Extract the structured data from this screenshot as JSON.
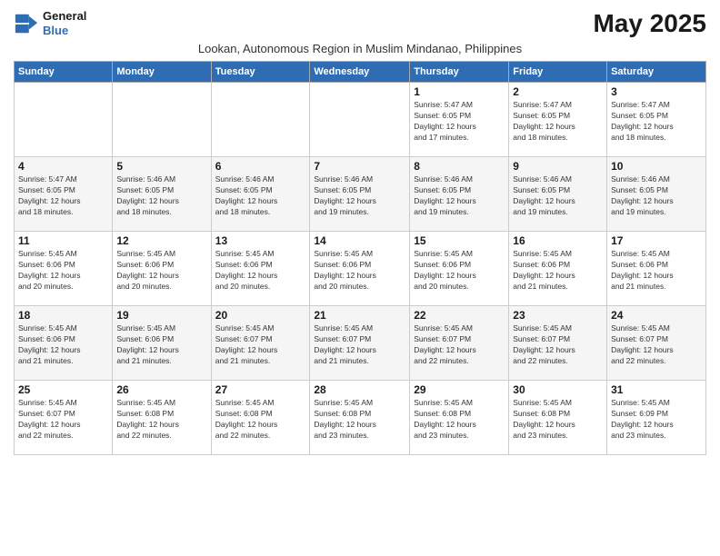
{
  "logo": {
    "line1": "General",
    "line2": "Blue"
  },
  "title": "May 2025",
  "subtitle": "Lookan, Autonomous Region in Muslim Mindanao, Philippines",
  "days_of_week": [
    "Sunday",
    "Monday",
    "Tuesday",
    "Wednesday",
    "Thursday",
    "Friday",
    "Saturday"
  ],
  "weeks": [
    [
      {
        "day": "",
        "info": ""
      },
      {
        "day": "",
        "info": ""
      },
      {
        "day": "",
        "info": ""
      },
      {
        "day": "",
        "info": ""
      },
      {
        "day": "1",
        "info": "Sunrise: 5:47 AM\nSunset: 6:05 PM\nDaylight: 12 hours\nand 17 minutes."
      },
      {
        "day": "2",
        "info": "Sunrise: 5:47 AM\nSunset: 6:05 PM\nDaylight: 12 hours\nand 18 minutes."
      },
      {
        "day": "3",
        "info": "Sunrise: 5:47 AM\nSunset: 6:05 PM\nDaylight: 12 hours\nand 18 minutes."
      }
    ],
    [
      {
        "day": "4",
        "info": "Sunrise: 5:47 AM\nSunset: 6:05 PM\nDaylight: 12 hours\nand 18 minutes."
      },
      {
        "day": "5",
        "info": "Sunrise: 5:46 AM\nSunset: 6:05 PM\nDaylight: 12 hours\nand 18 minutes."
      },
      {
        "day": "6",
        "info": "Sunrise: 5:46 AM\nSunset: 6:05 PM\nDaylight: 12 hours\nand 18 minutes."
      },
      {
        "day": "7",
        "info": "Sunrise: 5:46 AM\nSunset: 6:05 PM\nDaylight: 12 hours\nand 19 minutes."
      },
      {
        "day": "8",
        "info": "Sunrise: 5:46 AM\nSunset: 6:05 PM\nDaylight: 12 hours\nand 19 minutes."
      },
      {
        "day": "9",
        "info": "Sunrise: 5:46 AM\nSunset: 6:05 PM\nDaylight: 12 hours\nand 19 minutes."
      },
      {
        "day": "10",
        "info": "Sunrise: 5:46 AM\nSunset: 6:05 PM\nDaylight: 12 hours\nand 19 minutes."
      }
    ],
    [
      {
        "day": "11",
        "info": "Sunrise: 5:45 AM\nSunset: 6:06 PM\nDaylight: 12 hours\nand 20 minutes."
      },
      {
        "day": "12",
        "info": "Sunrise: 5:45 AM\nSunset: 6:06 PM\nDaylight: 12 hours\nand 20 minutes."
      },
      {
        "day": "13",
        "info": "Sunrise: 5:45 AM\nSunset: 6:06 PM\nDaylight: 12 hours\nand 20 minutes."
      },
      {
        "day": "14",
        "info": "Sunrise: 5:45 AM\nSunset: 6:06 PM\nDaylight: 12 hours\nand 20 minutes."
      },
      {
        "day": "15",
        "info": "Sunrise: 5:45 AM\nSunset: 6:06 PM\nDaylight: 12 hours\nand 20 minutes."
      },
      {
        "day": "16",
        "info": "Sunrise: 5:45 AM\nSunset: 6:06 PM\nDaylight: 12 hours\nand 21 minutes."
      },
      {
        "day": "17",
        "info": "Sunrise: 5:45 AM\nSunset: 6:06 PM\nDaylight: 12 hours\nand 21 minutes."
      }
    ],
    [
      {
        "day": "18",
        "info": "Sunrise: 5:45 AM\nSunset: 6:06 PM\nDaylight: 12 hours\nand 21 minutes."
      },
      {
        "day": "19",
        "info": "Sunrise: 5:45 AM\nSunset: 6:06 PM\nDaylight: 12 hours\nand 21 minutes."
      },
      {
        "day": "20",
        "info": "Sunrise: 5:45 AM\nSunset: 6:07 PM\nDaylight: 12 hours\nand 21 minutes."
      },
      {
        "day": "21",
        "info": "Sunrise: 5:45 AM\nSunset: 6:07 PM\nDaylight: 12 hours\nand 21 minutes."
      },
      {
        "day": "22",
        "info": "Sunrise: 5:45 AM\nSunset: 6:07 PM\nDaylight: 12 hours\nand 22 minutes."
      },
      {
        "day": "23",
        "info": "Sunrise: 5:45 AM\nSunset: 6:07 PM\nDaylight: 12 hours\nand 22 minutes."
      },
      {
        "day": "24",
        "info": "Sunrise: 5:45 AM\nSunset: 6:07 PM\nDaylight: 12 hours\nand 22 minutes."
      }
    ],
    [
      {
        "day": "25",
        "info": "Sunrise: 5:45 AM\nSunset: 6:07 PM\nDaylight: 12 hours\nand 22 minutes."
      },
      {
        "day": "26",
        "info": "Sunrise: 5:45 AM\nSunset: 6:08 PM\nDaylight: 12 hours\nand 22 minutes."
      },
      {
        "day": "27",
        "info": "Sunrise: 5:45 AM\nSunset: 6:08 PM\nDaylight: 12 hours\nand 22 minutes."
      },
      {
        "day": "28",
        "info": "Sunrise: 5:45 AM\nSunset: 6:08 PM\nDaylight: 12 hours\nand 23 minutes."
      },
      {
        "day": "29",
        "info": "Sunrise: 5:45 AM\nSunset: 6:08 PM\nDaylight: 12 hours\nand 23 minutes."
      },
      {
        "day": "30",
        "info": "Sunrise: 5:45 AM\nSunset: 6:08 PM\nDaylight: 12 hours\nand 23 minutes."
      },
      {
        "day": "31",
        "info": "Sunrise: 5:45 AM\nSunset: 6:09 PM\nDaylight: 12 hours\nand 23 minutes."
      }
    ]
  ]
}
